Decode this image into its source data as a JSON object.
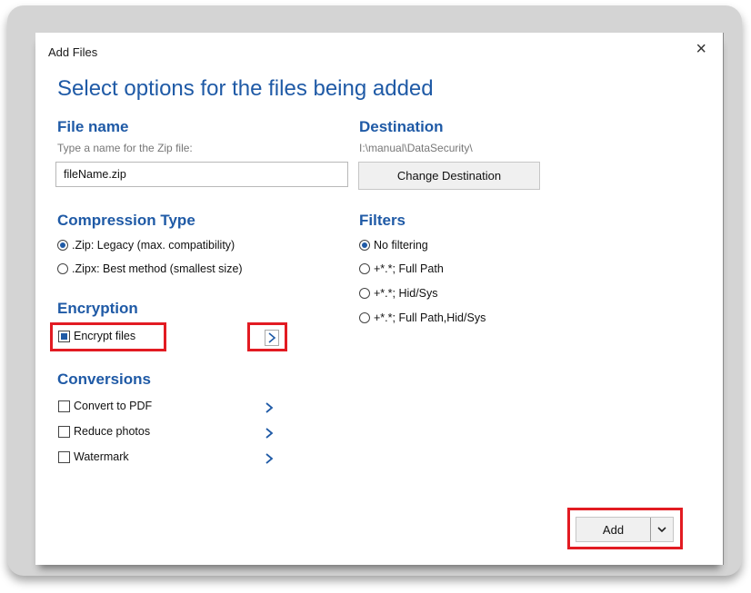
{
  "window": {
    "title": "Add Files",
    "close_glyph": "×"
  },
  "heading": "Select options for the files being added",
  "file_name": {
    "label": "File name",
    "hint": "Type a name for the Zip file:",
    "value": "fileName.zip"
  },
  "destination": {
    "label": "Destination",
    "path": "I:\\manual\\DataSecurity\\",
    "change_button": "Change Destination"
  },
  "compression": {
    "label": "Compression Type",
    "options": [
      {
        "label": ".Zip: Legacy (max. compatibility)",
        "selected": true
      },
      {
        "label": ".Zipx: Best method (smallest size)",
        "selected": false
      }
    ]
  },
  "filters": {
    "label": "Filters",
    "options": [
      {
        "label": "No filtering",
        "selected": true
      },
      {
        "label": "+*.*; Full Path",
        "selected": false
      },
      {
        "label": "+*.*; Hid/Sys",
        "selected": false
      },
      {
        "label": "+*.*; Full Path,Hid/Sys",
        "selected": false
      }
    ]
  },
  "encryption": {
    "label": "Encryption",
    "encrypt_files": {
      "label": "Encrypt files",
      "checked": true
    }
  },
  "conversions": {
    "label": "Conversions",
    "items": [
      {
        "label": "Convert to PDF",
        "checked": false
      },
      {
        "label": "Reduce photos",
        "checked": false
      },
      {
        "label": "Watermark",
        "checked": false
      }
    ]
  },
  "footer": {
    "add_button": "Add"
  },
  "colors": {
    "accent": "#1f5aa6",
    "highlight": "#e21b22"
  },
  "icons": [
    "close-icon",
    "chevron-right-icon",
    "chevron-down-icon"
  ]
}
